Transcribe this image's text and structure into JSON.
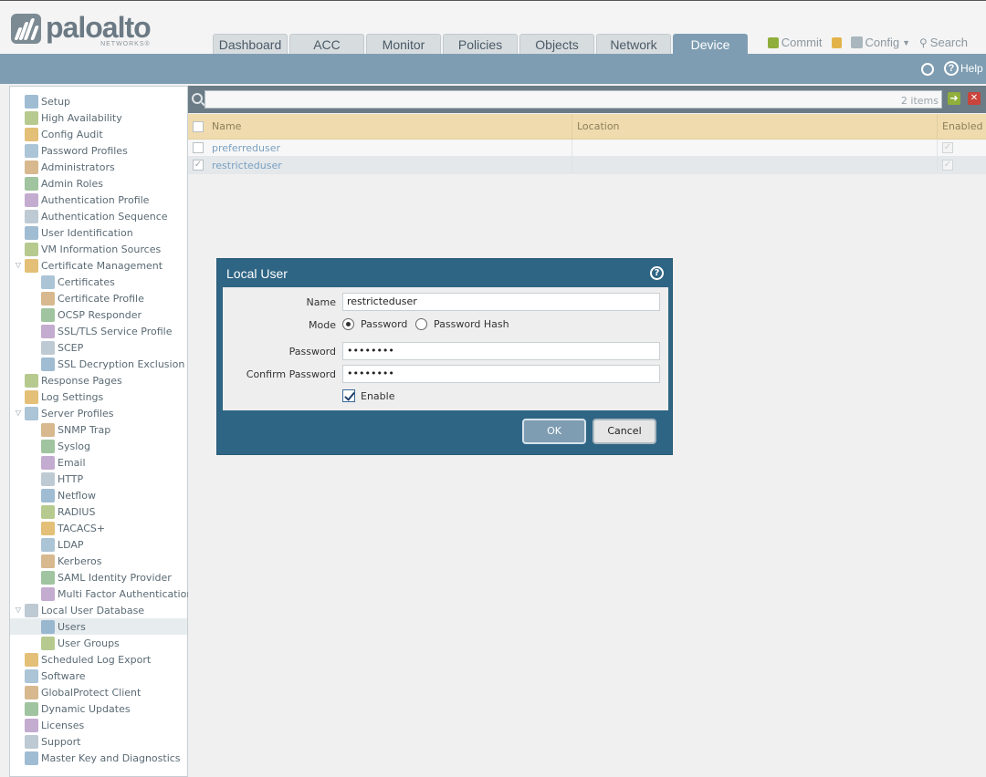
{
  "brand": {
    "name": "paloalto",
    "sub": "NETWORKS®"
  },
  "tabs": [
    "Dashboard",
    "ACC",
    "Monitor",
    "Policies",
    "Objects",
    "Network",
    "Device"
  ],
  "active_tab": "Device",
  "toplinks": {
    "commit": "Commit",
    "config": "Config",
    "search": "Search"
  },
  "strip": {
    "help": "Help"
  },
  "sidebar": {
    "items": [
      {
        "label": "Setup",
        "level": 0,
        "icon": "setup-icon"
      },
      {
        "label": "High Availability",
        "level": 0,
        "icon": "ha-icon"
      },
      {
        "label": "Config Audit",
        "level": 0,
        "icon": "audit-icon"
      },
      {
        "label": "Password Profiles",
        "level": 0,
        "icon": "password-profile-icon"
      },
      {
        "label": "Administrators",
        "level": 0,
        "icon": "admin-icon"
      },
      {
        "label": "Admin Roles",
        "level": 0,
        "icon": "admin-role-icon"
      },
      {
        "label": "Authentication Profile",
        "level": 0,
        "icon": "auth-profile-icon"
      },
      {
        "label": "Authentication Sequence",
        "level": 0,
        "icon": "auth-sequence-icon"
      },
      {
        "label": "User Identification",
        "level": 0,
        "icon": "user-id-icon"
      },
      {
        "label": "VM Information Sources",
        "level": 0,
        "icon": "vm-info-icon"
      },
      {
        "label": "Certificate Management",
        "level": 0,
        "icon": "cert-mgmt-icon",
        "expander": true
      },
      {
        "label": "Certificates",
        "level": 1,
        "icon": "certificate-icon"
      },
      {
        "label": "Certificate Profile",
        "level": 1,
        "icon": "cert-profile-icon"
      },
      {
        "label": "OCSP Responder",
        "level": 1,
        "icon": "ocsp-icon"
      },
      {
        "label": "SSL/TLS Service Profile",
        "level": 1,
        "icon": "lock-icon"
      },
      {
        "label": "SCEP",
        "level": 1,
        "icon": "scep-icon"
      },
      {
        "label": "SSL Decryption Exclusion",
        "level": 1,
        "icon": "lock-icon"
      },
      {
        "label": "Response Pages",
        "level": 0,
        "icon": "response-pages-icon"
      },
      {
        "label": "Log Settings",
        "level": 0,
        "icon": "log-settings-icon"
      },
      {
        "label": "Server Profiles",
        "level": 0,
        "icon": "server-profiles-icon",
        "expander": true
      },
      {
        "label": "SNMP Trap",
        "level": 1,
        "icon": "snmp-icon"
      },
      {
        "label": "Syslog",
        "level": 1,
        "icon": "syslog-icon"
      },
      {
        "label": "Email",
        "level": 1,
        "icon": "email-icon"
      },
      {
        "label": "HTTP",
        "level": 1,
        "icon": "http-icon"
      },
      {
        "label": "Netflow",
        "level": 1,
        "icon": "netflow-icon"
      },
      {
        "label": "RADIUS",
        "level": 1,
        "icon": "radius-icon"
      },
      {
        "label": "TACACS+",
        "level": 1,
        "icon": "tacacs-icon"
      },
      {
        "label": "LDAP",
        "level": 1,
        "icon": "ldap-icon"
      },
      {
        "label": "Kerberos",
        "level": 1,
        "icon": "kerberos-icon"
      },
      {
        "label": "SAML Identity Provider",
        "level": 1,
        "icon": "saml-icon"
      },
      {
        "label": "Multi Factor Authentication",
        "level": 1,
        "icon": "mfa-icon"
      },
      {
        "label": "Local User Database",
        "level": 0,
        "icon": "local-db-icon",
        "expander": true
      },
      {
        "label": "Users",
        "level": 1,
        "icon": "user-icon",
        "selected": true
      },
      {
        "label": "User Groups",
        "level": 1,
        "icon": "user-group-icon"
      },
      {
        "label": "Scheduled Log Export",
        "level": 0,
        "icon": "log-export-icon"
      },
      {
        "label": "Software",
        "level": 0,
        "icon": "software-icon"
      },
      {
        "label": "GlobalProtect Client",
        "level": 0,
        "icon": "globalprotect-icon"
      },
      {
        "label": "Dynamic Updates",
        "level": 0,
        "icon": "dynamic-updates-icon"
      },
      {
        "label": "Licenses",
        "level": 0,
        "icon": "licenses-icon"
      },
      {
        "label": "Support",
        "level": 0,
        "icon": "support-icon"
      },
      {
        "label": "Master Key and Diagnostics",
        "level": 0,
        "icon": "lock-icon"
      }
    ]
  },
  "search": {
    "placeholder": "",
    "count": "2 items"
  },
  "table": {
    "headers": {
      "name": "Name",
      "location": "Location",
      "enabled": "Enabled"
    },
    "rows": [
      {
        "name": "preferreduser",
        "location": "",
        "enabled": true,
        "checked": false
      },
      {
        "name": "restricteduser",
        "location": "",
        "enabled": true,
        "checked": true
      }
    ]
  },
  "dialog": {
    "title": "Local User",
    "labels": {
      "name": "Name",
      "mode": "Mode",
      "password": "Password",
      "confirm": "Confirm Password"
    },
    "values": {
      "name": "restricteduser",
      "password": "••••••••",
      "confirm": "••••••••"
    },
    "mode_options": [
      "Password",
      "Password Hash"
    ],
    "mode_selected": "Password",
    "enable_label": "Enable",
    "enable_checked": true,
    "ok": "OK",
    "cancel": "Cancel"
  },
  "colors": {
    "accent_blue": "#7e9db2",
    "dialog_blue": "#2f6584",
    "header_tan": "#efdbae"
  }
}
